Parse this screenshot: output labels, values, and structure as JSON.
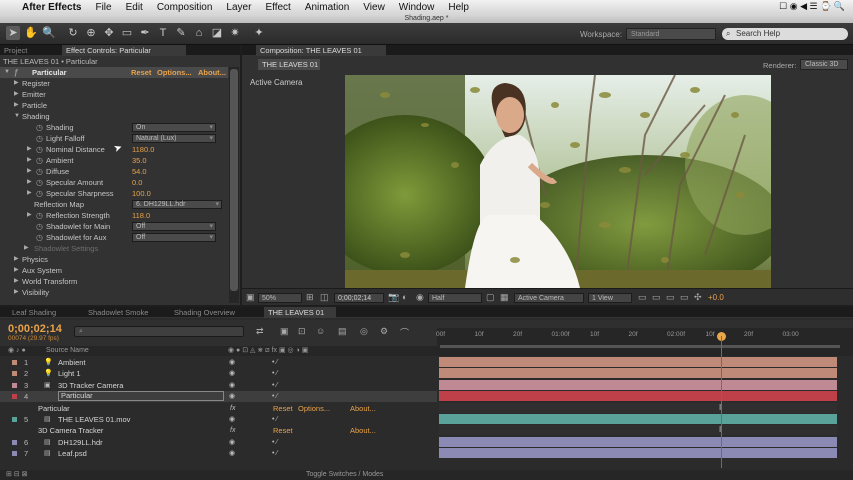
{
  "menubar": {
    "app_name": "After Effects",
    "items": [
      "File",
      "Edit",
      "Composition",
      "Layer",
      "Effect",
      "Animation",
      "View",
      "Window",
      "Help"
    ],
    "right_text": "☐ ◉ ◀ ☰ ⌚ 🔍"
  },
  "document_title": "Shading.aep *",
  "toolbar": {
    "workspace_label": "Workspace:",
    "workspace_value": "Standard",
    "search_placeholder": "Search Help"
  },
  "effect_controls": {
    "tab_project": "Project",
    "tab_label": "Effect Controls: Particular",
    "header": "THE LEAVES 01 • Particular",
    "effect_name": "Particular",
    "reset": "Reset",
    "options": "Options...",
    "about": "About...",
    "rows": [
      {
        "label": "Register",
        "indent": 1,
        "tri": "▶"
      },
      {
        "label": "Emitter",
        "indent": 1,
        "tri": "▶"
      },
      {
        "label": "Particle",
        "indent": 1,
        "tri": "▶"
      },
      {
        "label": "Shading",
        "indent": 1,
        "tri": "▼"
      },
      {
        "label": "Shading",
        "indent": 3,
        "dropdown": "On"
      },
      {
        "label": "Light Falloff",
        "indent": 3,
        "dropdown": "Natural (Lux)"
      },
      {
        "label": "Nominal Distance",
        "indent": 3,
        "tri": "▶",
        "value": "1180.0"
      },
      {
        "label": "Ambient",
        "indent": 3,
        "tri": "▶",
        "value": "35.0"
      },
      {
        "label": "Diffuse",
        "indent": 3,
        "tri": "▶",
        "value": "54.0"
      },
      {
        "label": "Specular Amount",
        "indent": 3,
        "tri": "▶",
        "value": "0.0"
      },
      {
        "label": "Specular Sharpness",
        "indent": 3,
        "tri": "▶",
        "value": "100.0"
      },
      {
        "label": "Reflection Map",
        "indent": 2,
        "dropdown": "6. DH129LL.hdr"
      },
      {
        "label": "Reflection Strength",
        "indent": 3,
        "tri": "▶",
        "value": "118.0"
      },
      {
        "label": "Shadowlet for Main",
        "indent": 3,
        "dropdown": "Off"
      },
      {
        "label": "Shadowlet for Aux",
        "indent": 3,
        "dropdown": "Off"
      },
      {
        "label": "Shadowlet Settings",
        "indent": 2,
        "tri": "▶",
        "dim": true
      },
      {
        "label": "Physics",
        "indent": 1,
        "tri": "▶"
      },
      {
        "label": "Aux System",
        "indent": 1,
        "tri": "▶"
      },
      {
        "label": "World Transform",
        "indent": 1,
        "tri": "▶"
      },
      {
        "label": "Visibility",
        "indent": 1,
        "tri": "▶"
      }
    ]
  },
  "composition": {
    "tab_label": "Composition: THE LEAVES 01",
    "subtab": "THE LEAVES 01",
    "active_camera": "Active Camera",
    "renderer_label": "Renderer:",
    "renderer_value": "Classic 3D",
    "zoom": "50%",
    "timecode": "0;00;02;14",
    "resolution": "Half",
    "view": "Active Camera",
    "views": "1 View",
    "exposure": "+0.0"
  },
  "timeline": {
    "tabs": [
      "Leaf Shading",
      "Shadowlet Smoke",
      "Shading Overview",
      "THE LEAVES 01"
    ],
    "timecode": "0;00;02;14",
    "fps": "00074 (29.97 fps)",
    "search_placeholder": "",
    "col_source": "Source Name",
    "col_parent": "Parent",
    "ruler": [
      "00f",
      "10f",
      "20f",
      "01:00f",
      "10f",
      "20f",
      "02:00f",
      "10f",
      "20f",
      "03:00"
    ],
    "layers": [
      {
        "num": "1",
        "icon": "💡",
        "name": "Ambient",
        "color": "#c08a78"
      },
      {
        "num": "2",
        "icon": "💡",
        "name": "Light 1",
        "color": "#c08a78"
      },
      {
        "num": "3",
        "icon": "▣",
        "name": "3D Tracker Camera",
        "color": "#c08a95"
      },
      {
        "num": "4",
        "icon": "",
        "name": "Particular",
        "color": "#c0404a",
        "selected": true
      },
      {
        "sub": "Particular",
        "fx": "fx",
        "reset": "Reset",
        "options": "Options...",
        "about": "About..."
      },
      {
        "num": "5",
        "icon": "▤",
        "name": "THE LEAVES 01.mov",
        "color": "#5aa39a"
      },
      {
        "sub": "3D Camera Tracker",
        "fx": "fx",
        "reset": "Reset",
        "about": "About..."
      },
      {
        "num": "6",
        "icon": "▤",
        "name": "DH129LL.hdr",
        "color": "#8a8ab5"
      },
      {
        "num": "7",
        "icon": "▤",
        "name": "Leaf.psd",
        "color": "#8a8ab5"
      }
    ],
    "toggle_label": "Toggle Switches / Modes"
  },
  "colors": {
    "accent": "#e8a24a",
    "playhead": "#e03c3c"
  }
}
